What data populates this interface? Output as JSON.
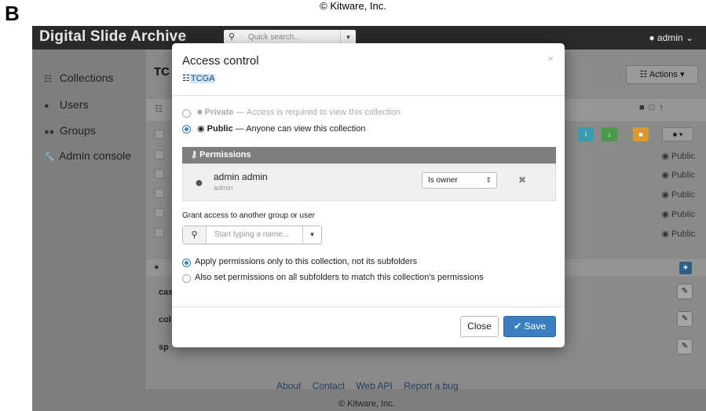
{
  "figure": {
    "label": "B",
    "credit": "© Kitware, Inc."
  },
  "navbar": {
    "brand": "Digital Slide Archive",
    "search_icon": "search-icon",
    "search_placeholder": "Quick search...",
    "user_label": "admin",
    "user_icon": "user-icon"
  },
  "sidebar": {
    "items": [
      {
        "label": "Collections",
        "icon": "sitemap-icon"
      },
      {
        "label": "Users",
        "icon": "user-icon"
      },
      {
        "label": "Groups",
        "icon": "users-icon"
      },
      {
        "label": "Admin console",
        "icon": "wrench-icon"
      }
    ]
  },
  "content": {
    "title": "TC",
    "actions_label": "Actions",
    "public_labels": [
      "Public",
      "Public",
      "Public",
      "Public",
      "Public"
    ],
    "metadata_keys": [
      "cas",
      "col",
      "sp"
    ]
  },
  "modal": {
    "title": "Access control",
    "subtitle": "TCGA",
    "close_glyph": "×",
    "options": {
      "private_bold": "Private",
      "private_text": " — Access is required to view this collection",
      "public_bold": "Public",
      "public_text": " — Anyone can view this collection"
    },
    "permissions": {
      "header": "Permissions",
      "rows": [
        {
          "name": "admin admin",
          "login": "admin",
          "level": "Is owner"
        }
      ]
    },
    "grant": {
      "label": "Grant access to another group or user",
      "placeholder": "Start typing a name..."
    },
    "recurse": {
      "only_this": "Apply permissions only to this collection, not its subfolders",
      "all_sub": "Also set permissions on all subfolders to match this collection's permissions"
    },
    "buttons": {
      "close": "Close",
      "save": "Save"
    }
  },
  "footer": {
    "links": [
      "About",
      "Contact",
      "Web API",
      "Report a bug"
    ],
    "credit": "© Kitware, Inc."
  },
  "colors": {
    "navbar": "#2a2a2a",
    "accent": "#3b7fc0",
    "overlay": "#7e7e7e",
    "info_button": "#3a9bb0",
    "success_button": "#4a9a4a",
    "warning_button": "#d89a2a"
  }
}
